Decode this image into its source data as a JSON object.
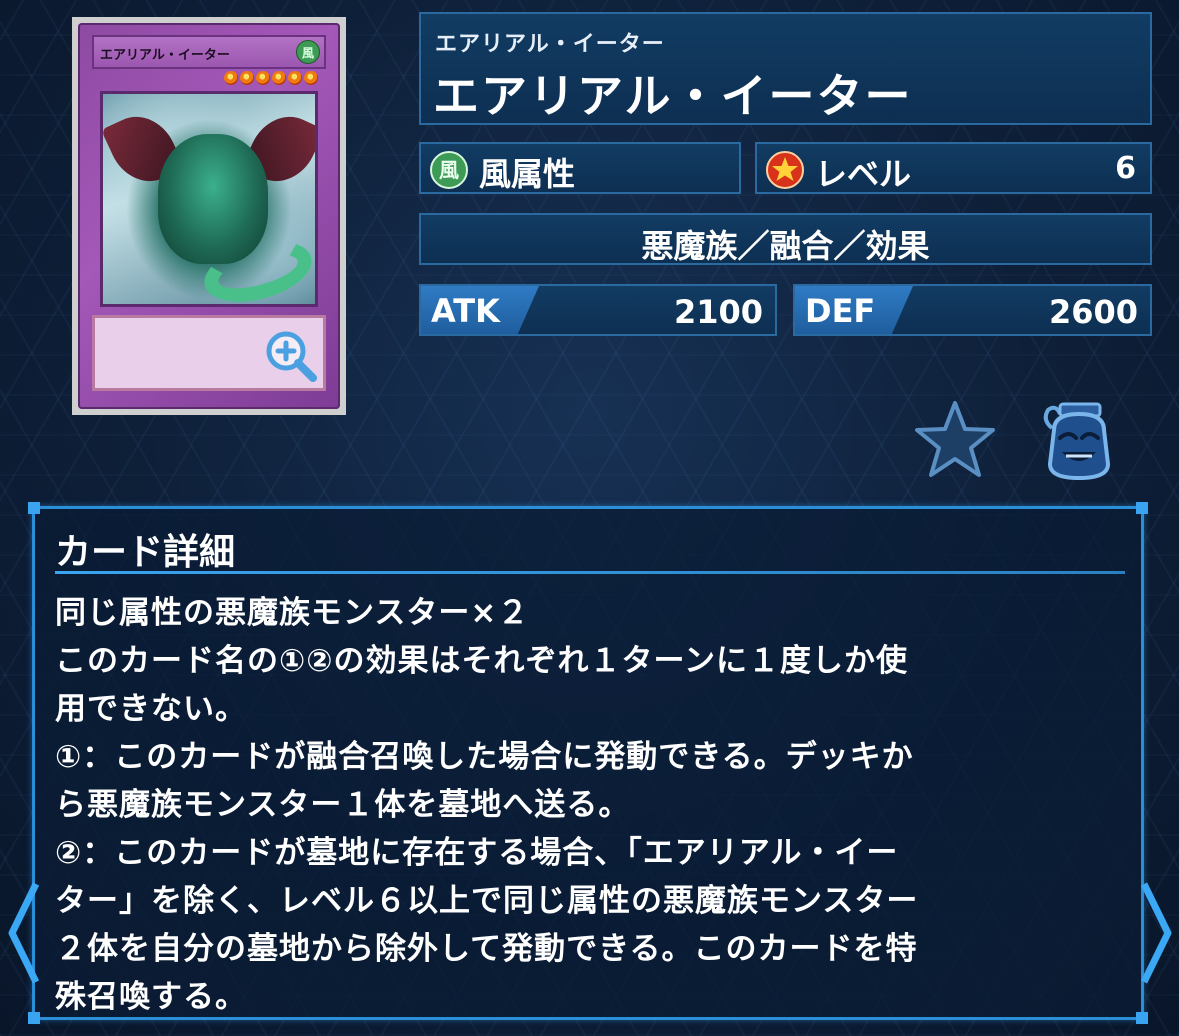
{
  "card": {
    "name": "エアリアル・イーター",
    "attribute_glyph": "風",
    "stars": 6,
    "frame_color": "#9a55ae",
    "zoom_icon": "magnify-plus-icon"
  },
  "header": {
    "name_reading": "エアリアル・イーター",
    "name": "エアリアル・イーター"
  },
  "attribute": {
    "icon": "wind-attribute-icon",
    "glyph": "風",
    "label": "風属性"
  },
  "level": {
    "icon": "level-star-icon",
    "label": "レベル",
    "value": "6"
  },
  "type_line": "悪魔族／融合／効果",
  "stats": {
    "atk_label": "ATK",
    "atk_value": "2100",
    "def_label": "DEF",
    "def_value": "2600"
  },
  "actions": {
    "favorite_icon": "star-icon",
    "pot_icon": "pot-of-greed-icon"
  },
  "detail": {
    "title": "カード詳細",
    "text": "同じ属性の悪魔族モンスター×２\nこのカード名の①②の効果はそれぞれ１ターンに１度しか使\n用できない。\n①：このカードが融合召喚した場合に発動できる。デッキか\nら悪魔族モンスター１体を墓地へ送る。\n②：このカードが墓地に存在する場合、「エアリアル・イー\nター」を除く、レベル６以上で同じ属性の悪魔族モンスター\n２体を自分の墓地から除外して発動できる。このカードを特\n殊召喚する。"
  },
  "nav": {
    "prev_icon": "chevron-left-icon",
    "next_icon": "chevron-right-icon"
  },
  "colors": {
    "accent": "#2a8fd6",
    "panel": "#123c63",
    "wind": "#3d9b55",
    "level_red": "#d8321a"
  }
}
